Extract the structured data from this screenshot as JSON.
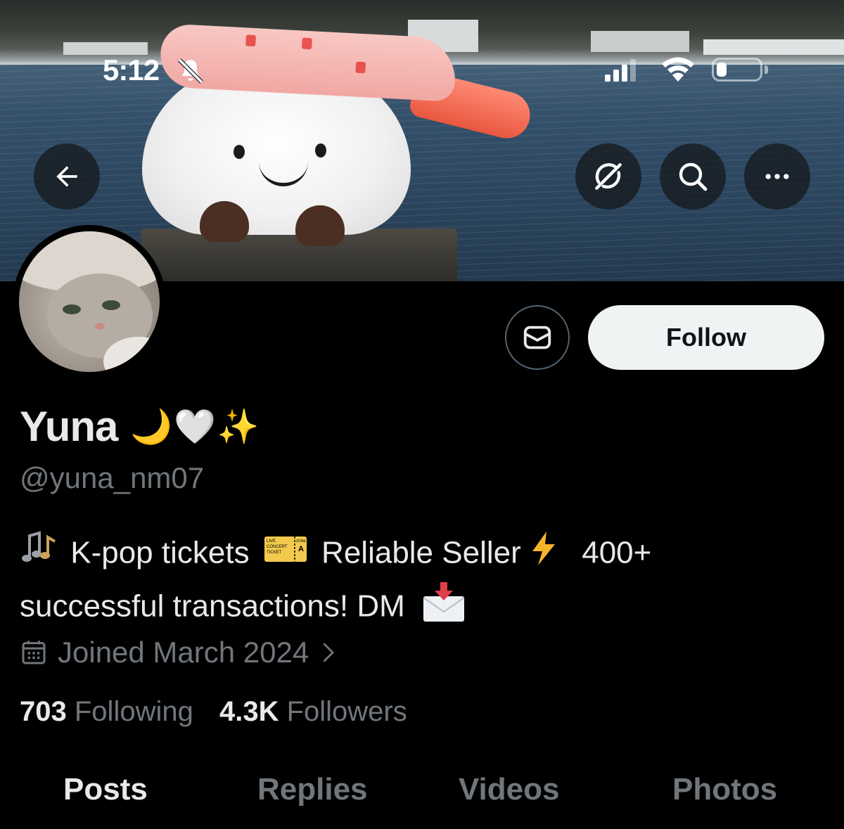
{
  "status_bar": {
    "time": "5:12"
  },
  "header": {
    "back_icon": "arrow-left-icon",
    "actions": [
      "grok-icon",
      "search-icon",
      "more-icon"
    ]
  },
  "profile": {
    "display_name": "Yuna",
    "name_emojis": "🌙🤍✨",
    "handle": "@yuna_nm07",
    "bio_part1": "K-pop tickets",
    "bio_part2": "Reliable Seller",
    "bio_part3": "400+",
    "bio_line2": "successful transactions! DM",
    "ticket_text": {
      "live": "LIVE",
      "concert": "CONCERT",
      "ticket": "TICKET",
      "zone": "ZONE",
      "zone_letter": "A"
    },
    "joined": "Joined March 2024",
    "following_count": "703",
    "following_label": "Following",
    "followers_count": "4.3K",
    "followers_label": "Followers"
  },
  "buttons": {
    "follow_label": "Follow"
  },
  "tabs": [
    "Posts",
    "Replies",
    "Videos",
    "Photos"
  ],
  "colors": {
    "background": "#000000",
    "text_primary": "#e7e9ea",
    "text_secondary": "#71767b",
    "follow_bg": "#eff3f4"
  }
}
